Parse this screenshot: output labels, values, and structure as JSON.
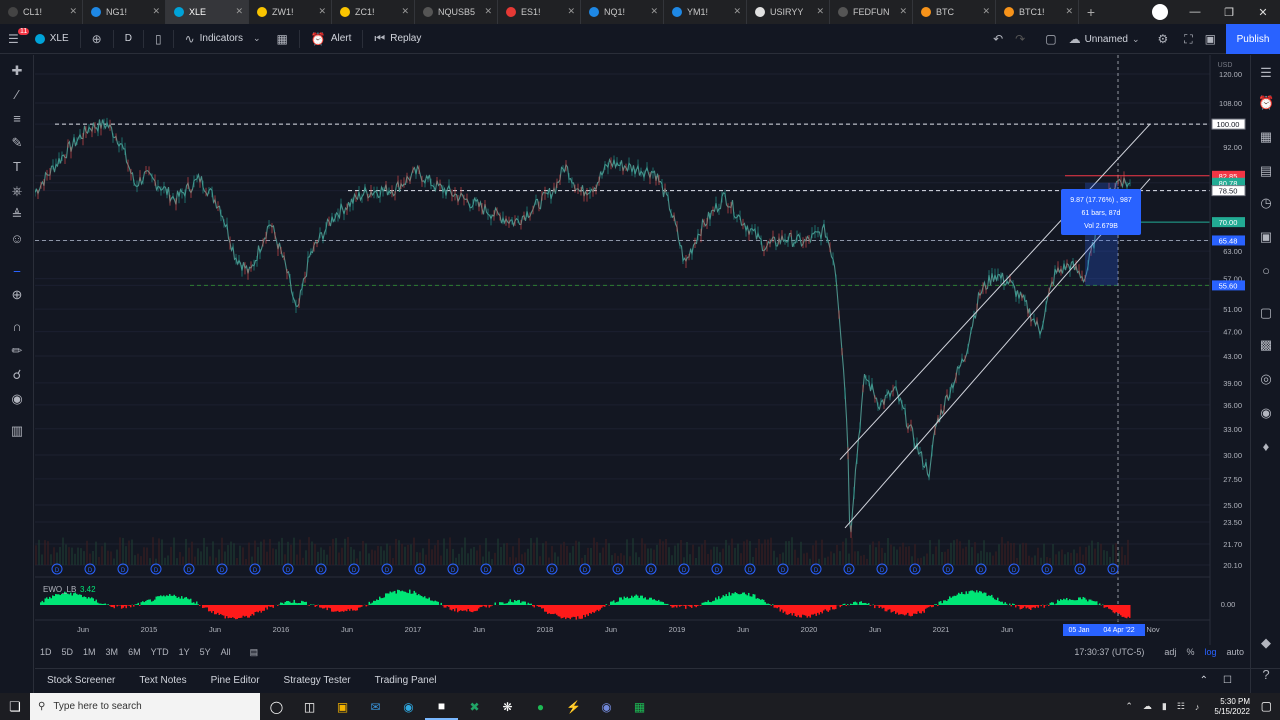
{
  "browser": {
    "tabs": [
      {
        "label": "CL1!",
        "color": "#444"
      },
      {
        "label": "NG1!",
        "color": "#1e88e5"
      },
      {
        "label": "XLE",
        "color": "#00a3d9",
        "active": true
      },
      {
        "label": "ZW1!",
        "color": "#f9c400"
      },
      {
        "label": "ZC1!",
        "color": "#f9c400"
      },
      {
        "label": "NQUSB5",
        "color": "#555"
      },
      {
        "label": "ES1!",
        "color": "#e53935"
      },
      {
        "label": "NQ1!",
        "color": "#1e88e5"
      },
      {
        "label": "YM1!",
        "color": "#1e88e5"
      },
      {
        "label": "USIRYY",
        "color": "#e0e0e0"
      },
      {
        "label": "FEDFUN",
        "color": "#555"
      },
      {
        "label": "BTC",
        "color": "#f7931a"
      },
      {
        "label": "BTC1!",
        "color": "#f7931a"
      }
    ]
  },
  "toolbar": {
    "symbol": "XLE",
    "interval": "D",
    "indicators": "Indicators",
    "alert": "Alert",
    "replay": "Replay",
    "layout_name": "Unnamed",
    "publish": "Publish",
    "notification_count": "11"
  },
  "chart": {
    "currency": "USD",
    "price_axis": [
      "120.00",
      "108.00",
      "100.00",
      "92.00",
      "82.85",
      "80.78",
      "78.50",
      "70.00",
      "65.48",
      "63.00",
      "57.00",
      "55.60",
      "51.00",
      "47.00",
      "43.00",
      "39.00",
      "36.00",
      "33.00",
      "30.00",
      "27.50",
      "25.00",
      "23.50",
      "21.70",
      "20.10"
    ],
    "price_tags": [
      {
        "value": "100.00",
        "color": "#ffffff"
      },
      {
        "value": "82.85",
        "color": "#f23645"
      },
      {
        "value": "80.78",
        "color": "#22ab94"
      },
      {
        "value": "78.50",
        "color": "#ffffff"
      },
      {
        "value": "70.00",
        "color": "#22ab94"
      },
      {
        "value": "65.48",
        "color": "#2962ff"
      },
      {
        "value": "55.60",
        "color": "#2962ff"
      }
    ],
    "time_axis": [
      "Jun",
      "2015",
      "Jun",
      "2016",
      "Jun",
      "2017",
      "Jun",
      "2018",
      "Jun",
      "2019",
      "Jun",
      "2020",
      "Jun",
      "2021",
      "Jun",
      "Nov"
    ],
    "crosshair_date": "05 Jan",
    "crosshair_date2": "04 Apr '22",
    "measure": {
      "line1": "9.87 (17.76%) , 987",
      "line2": "61 bars, 87d",
      "line3": "Vol 2.679B"
    },
    "indicator": {
      "name": "EWO_LB",
      "value": "3.42"
    },
    "indicator_axis": "0.00",
    "dividend_marker": "D"
  },
  "range_bar": {
    "ranges": [
      "1D",
      "5D",
      "1M",
      "3M",
      "6M",
      "YTD",
      "1Y",
      "5Y",
      "All"
    ],
    "time": "17:30:37 (UTC-5)",
    "adj": "adj",
    "percent": "%",
    "log": "log",
    "auto": "auto"
  },
  "panels": [
    "Stock Screener",
    "Text Notes",
    "Pine Editor",
    "Strategy Tester",
    "Trading Panel"
  ],
  "taskbar": {
    "search_placeholder": "Type here to search",
    "time": "5:30 PM",
    "date": "5/15/2022"
  }
}
